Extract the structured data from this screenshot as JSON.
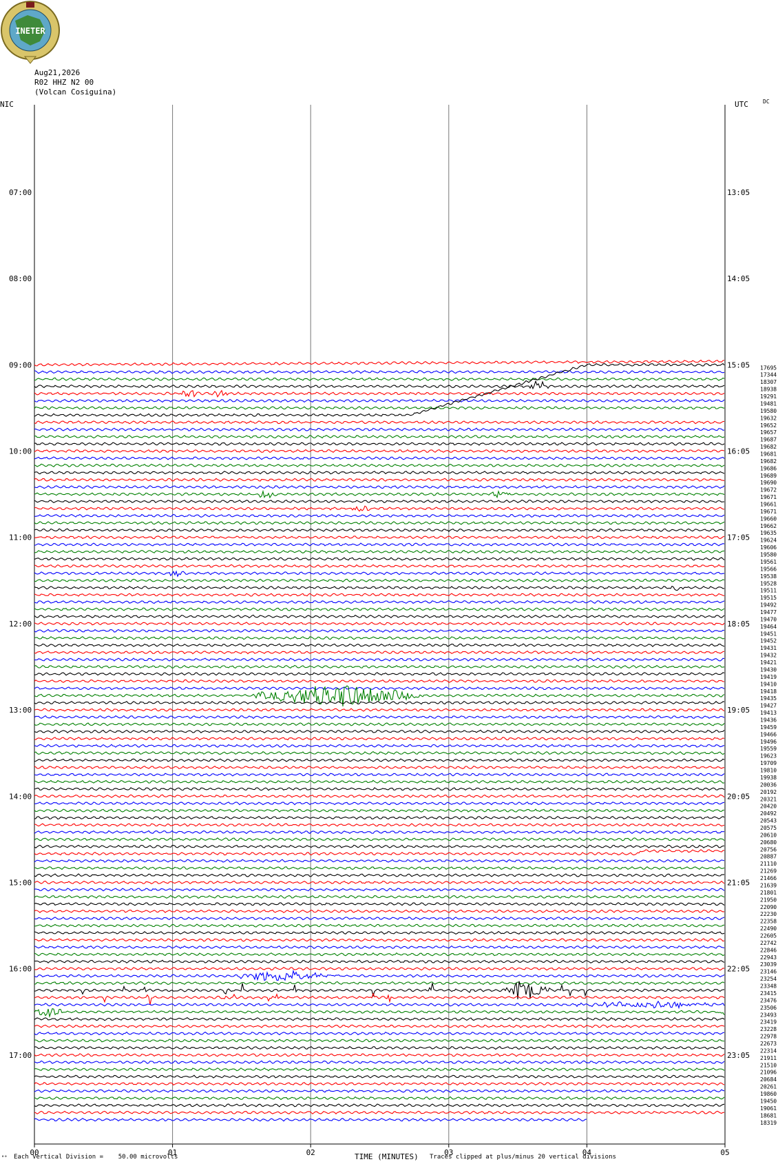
{
  "logo": {
    "text": "INETER",
    "colors": {
      "ring": "#d9c56a",
      "globe": "#5fa8c8",
      "land": "#3f8a3a",
      "text": "#ffffff"
    }
  },
  "header": {
    "date": "Aug21,2026",
    "station": "R02 HHZ N2 00",
    "location": "(Volcan Cosiguina)"
  },
  "left_corner": "NIC",
  "right_corner": "UTC",
  "right_corner_sub": "DC",
  "footer": {
    "scale_note": "Each Vertical Division =    50.00 microvolts",
    "small_mark": "°°",
    "xlabel": "TIME (MINUTES)",
    "clip_note": "Traces clipped at plus/minus 20 vertical divisions"
  },
  "chart_data": {
    "type": "line",
    "xlabel": "TIME (MINUTES)",
    "x_ticks": [
      "00",
      "01",
      "02",
      "03",
      "04",
      "05"
    ],
    "xlim": [
      0,
      5
    ],
    "grid": "vertical lines at each minute",
    "trace_interval_minutes": 5,
    "trace_colors": [
      "#000000",
      "#ff0000",
      "#0000ff",
      "#008000"
    ],
    "first_trace_color_index": 1,
    "empty_rows_before_data": 36,
    "left_time_labels": [
      {
        "label": "07:00",
        "row": 12
      },
      {
        "label": "08:00",
        "row": 24
      },
      {
        "label": "09:00",
        "row": 36
      },
      {
        "label": "10:00",
        "row": 48
      },
      {
        "label": "11:00",
        "row": 60
      },
      {
        "label": "12:00",
        "row": 72
      },
      {
        "label": "13:00",
        "row": 84
      },
      {
        "label": "14:00",
        "row": 96
      },
      {
        "label": "15:00",
        "row": 108
      },
      {
        "label": "16:00",
        "row": 120
      },
      {
        "label": "17:00",
        "row": 132
      }
    ],
    "right_time_labels": [
      {
        "label": "13:05",
        "row": 12
      },
      {
        "label": "14:05",
        "row": 24
      },
      {
        "label": "15:05",
        "row": 36
      },
      {
        "label": "16:05",
        "row": 48
      },
      {
        "label": "17:05",
        "row": 60
      },
      {
        "label": "18:05",
        "row": 72
      },
      {
        "label": "19:05",
        "row": 84
      },
      {
        "label": "20:05",
        "row": 96
      },
      {
        "label": "21:05",
        "row": 108
      },
      {
        "label": "22:05",
        "row": 120
      },
      {
        "label": "23:05",
        "row": 132
      }
    ],
    "trace_count_values": [
      "17695",
      "17344",
      "18307",
      "18938",
      "19291",
      "19481",
      "19580",
      "19632",
      "19652",
      "19657",
      "19687",
      "19682",
      "19681",
      "19682",
      "19686",
      "19689",
      "19690",
      "19672",
      "19671",
      "19661",
      "19671",
      "19660",
      "19662",
      "19635",
      "19624",
      "19606",
      "19580",
      "19561",
      "19566",
      "19538",
      "19528",
      "19511",
      "19515",
      "19492",
      "19477",
      "19470",
      "19464",
      "19451",
      "19452",
      "19431",
      "19432",
      "19421",
      "19430",
      "19419",
      "19410",
      "19418",
      "19435",
      "19427",
      "19413",
      "19436",
      "19459",
      "19466",
      "19496",
      "19559",
      "19623",
      "19709",
      "19810",
      "19938",
      "20036",
      "20192",
      "20321",
      "20420",
      "20492",
      "20543",
      "20575",
      "20610",
      "20680",
      "20756",
      "20887",
      "21110",
      "21269",
      "21466",
      "21639",
      "21801",
      "21950",
      "22090",
      "22230",
      "22358",
      "22490",
      "22605",
      "22742",
      "22846",
      "22943",
      "23039",
      "23146",
      "23254",
      "23348",
      "23415",
      "23476",
      "23506",
      "23493",
      "23419",
      "23228",
      "22978",
      "22673",
      "22314",
      "21911",
      "21510",
      "21096",
      "20684",
      "20261",
      "19860",
      "19450",
      "19061",
      "18681",
      "18319"
    ],
    "events": [
      {
        "trace": 0,
        "type": "drift-up",
        "x_start": 0.0,
        "x_end": 5.0
      },
      {
        "trace": 7,
        "type": "rising-drift",
        "x_start": 2.72,
        "x_end": 4.0
      },
      {
        "trace": 3,
        "type": "burst",
        "x": 3.58,
        "amplitude": "medium"
      },
      {
        "trace": 4,
        "type": "burst",
        "x": 1.05,
        "amplitude": "small"
      },
      {
        "trace": 4,
        "type": "burst",
        "x": 1.27,
        "amplitude": "small"
      },
      {
        "trace": 18,
        "type": "burst",
        "x": 1.6,
        "amplitude": "medium"
      },
      {
        "trace": 18,
        "type": "burst",
        "x": 3.3,
        "amplitude": "small"
      },
      {
        "trace": 20,
        "type": "burst",
        "x": 2.3,
        "amplitude": "small"
      },
      {
        "trace": 29,
        "type": "burst",
        "x": 0.95,
        "amplitude": "small"
      },
      {
        "trace": 31,
        "type": "burst",
        "x": 4.6,
        "amplitude": "small"
      },
      {
        "trace": 46,
        "type": "burst",
        "x": 1.6,
        "x_end": 2.8,
        "amplitude": "large"
      },
      {
        "trace": 68,
        "type": "step",
        "x": 4.38,
        "amplitude": "small"
      },
      {
        "trace": 85,
        "type": "burst",
        "x": 1.45,
        "x_end": 2.2,
        "amplitude": "medium"
      },
      {
        "trace": 87,
        "type": "spikes",
        "x": 0.25,
        "x_end": 4.6,
        "amplitude": "medium"
      },
      {
        "trace": 87,
        "type": "burst",
        "x": 3.4,
        "x_end": 3.7,
        "amplitude": "large"
      },
      {
        "trace": 88,
        "type": "spikes",
        "x": 0.5,
        "x_end": 2.8,
        "amplitude": "medium"
      },
      {
        "trace": 89,
        "type": "burst",
        "x": 3.9,
        "x_end": 5.0,
        "amplitude": "small"
      },
      {
        "trace": 90,
        "type": "burst",
        "x": 0.0,
        "x_end": 0.2,
        "amplitude": "medium"
      },
      {
        "trace": 90,
        "type": "burst",
        "x": 4.95,
        "amplitude": "medium"
      }
    ],
    "last_trace_end_minute": 4.0
  }
}
